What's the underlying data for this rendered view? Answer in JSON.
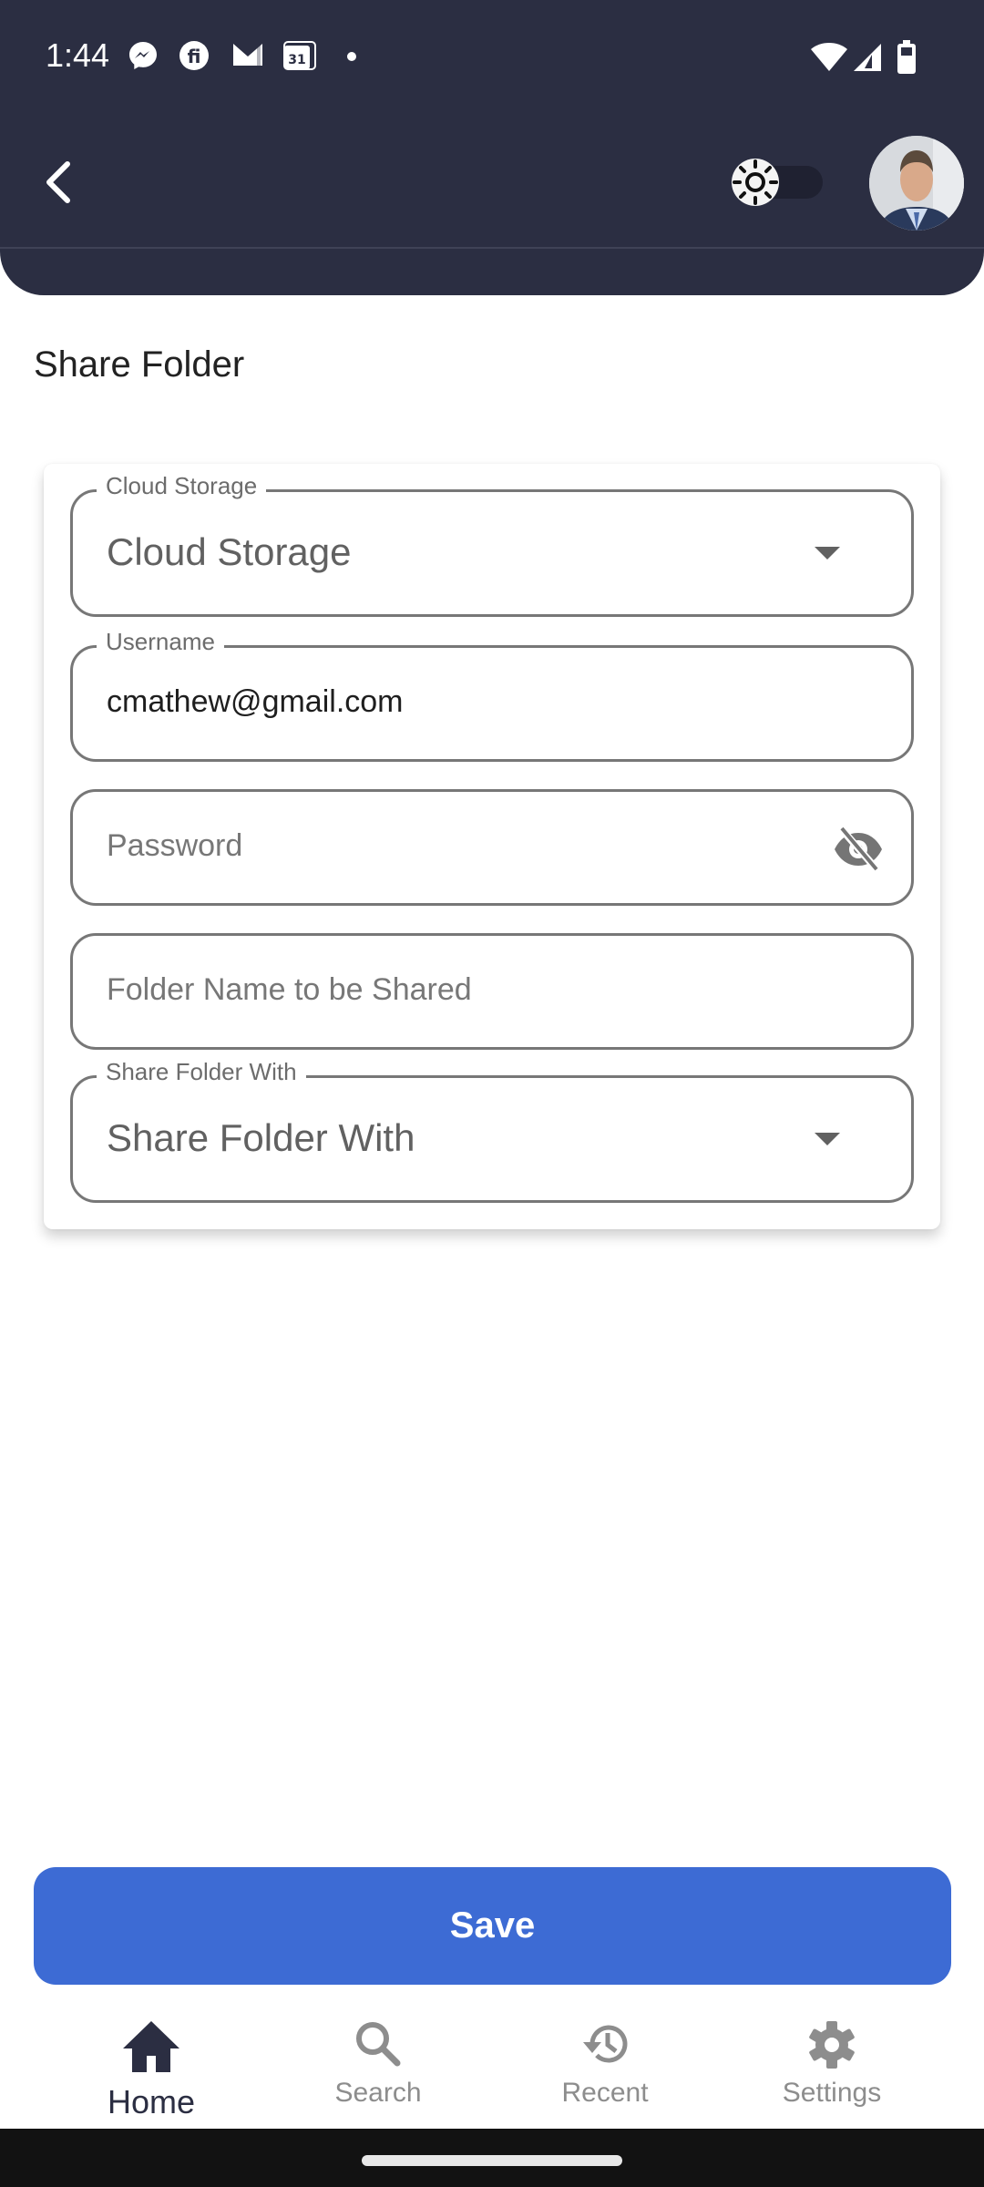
{
  "status_bar": {
    "time": "1:44",
    "notification_icons": [
      "messenger-icon",
      "fi-app-icon",
      "gmail-icon",
      "calendar-icon",
      "more-dot-icon"
    ],
    "calendar_day": "31",
    "system_icons": [
      "wifi-icon",
      "cellular-signal-icon",
      "battery-icon"
    ]
  },
  "header": {
    "back_icon": "chevron-left-icon",
    "theme_toggle": {
      "icon": "sun-icon",
      "state": "off"
    },
    "avatar": "user-avatar"
  },
  "page": {
    "title": "Share Folder"
  },
  "form": {
    "cloud_storage": {
      "label": "Cloud Storage",
      "value": "Cloud Storage",
      "icon": "dropdown-caret-icon"
    },
    "username": {
      "label": "Username",
      "value": "cmathew@gmail.com"
    },
    "password": {
      "placeholder": "Password",
      "value": "",
      "icon": "visibility-off-icon"
    },
    "folder_name": {
      "placeholder": "Folder Name to be Shared",
      "value": ""
    },
    "share_with": {
      "label": "Share Folder With",
      "value": "Share Folder With",
      "icon": "dropdown-caret-icon"
    }
  },
  "actions": {
    "save_label": "Save",
    "save_color": "#3d6bd4"
  },
  "bottom_nav": {
    "items": [
      {
        "label": "Home",
        "icon": "home-icon",
        "active": true
      },
      {
        "label": "Search",
        "icon": "search-icon",
        "active": false
      },
      {
        "label": "Recent",
        "icon": "history-icon",
        "active": false
      },
      {
        "label": "Settings",
        "icon": "gear-icon",
        "active": false
      }
    ]
  },
  "colors": {
    "header_bg": "#2b2e42",
    "accent": "#3d6bd4",
    "nav_active": "#2b2e42",
    "nav_inactive": "#8d8d8d"
  }
}
